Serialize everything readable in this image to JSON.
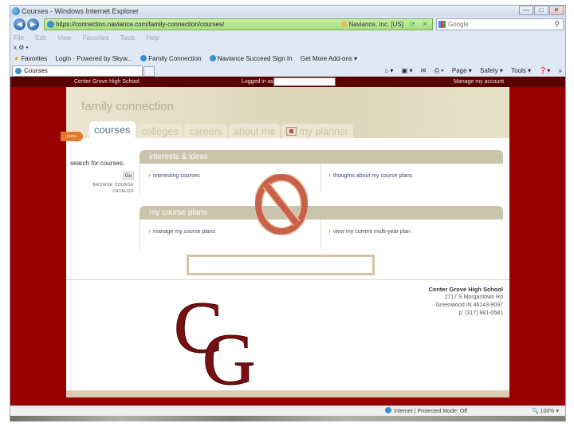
{
  "browser": {
    "window_title": "Courses - Windows Internet Explorer",
    "window_buttons": {
      "minimize": "—",
      "maximize": "□",
      "close": "✕"
    },
    "nav": {
      "back": "◀",
      "forward": "▶"
    },
    "address": "https://connection.naviance.com/family-connection/courses/",
    "cert_label": "Naviance, Inc. [US]",
    "address_tools": "⟳ ✕",
    "search_placeholder": "Google",
    "menu": [
      "File",
      "Edit",
      "View",
      "Favorites",
      "Tools",
      "Help"
    ],
    "command_row_text": "x  ⚙ •",
    "favorites_label": "Favorites",
    "favorites": [
      {
        "label": "Login · Powered by Skyw..."
      },
      {
        "label": "Family Connection"
      },
      {
        "label": "Naviance Succeed Sign In"
      },
      {
        "label": "Get More Add-ons ▾"
      }
    ],
    "tab_title": "Courses",
    "command_bar": [
      "⌂ ▾",
      "▣ ▾",
      "✉",
      "⎙ ▾",
      "Page ▾",
      "Safety ▾",
      "Tools ▾",
      "❓▾",
      "»"
    ],
    "status_zone": "Internet | Protected Mode: Off",
    "zoom_level": "100%"
  },
  "site": {
    "school_name_top": "Center Grove High School",
    "logged_in_label": "Logged in as",
    "logged_in_value": "",
    "manage_account": "Manage my account",
    "brand": "family connection",
    "home_tab": "home",
    "tabs": [
      {
        "label": "courses",
        "active": true
      },
      {
        "label": "colleges",
        "active": false
      },
      {
        "label": "careers",
        "active": false
      },
      {
        "label": "about me",
        "active": false
      },
      {
        "label": "my planner",
        "active": false
      }
    ],
    "sidebar": {
      "search_label": "search for courses:",
      "go_button": "Go",
      "browse_link": "BROWSE COURSE",
      "catalog_link": "CATALOG"
    },
    "panels": [
      {
        "title": "interests & ideas",
        "links": [
          "interesting courses",
          "thoughts about my course plans"
        ]
      },
      {
        "title": "my course plans",
        "links": [
          "manage my course plans",
          "view my current multi-year plan"
        ]
      }
    ],
    "overlay_icon": "prohibited-sign",
    "colors": {
      "maroon": "#990000",
      "dark_maroon": "#5a0000",
      "panel_head": "#c9c4ac",
      "no_sign": "#c8614a"
    },
    "footer": {
      "logo_text": "CG",
      "school_name": "Center Grove High School",
      "street": "2717 S Morgantown Rd",
      "city": "Greenwood IN 46143-9097",
      "phone": "p: (317) 881-0581"
    }
  }
}
